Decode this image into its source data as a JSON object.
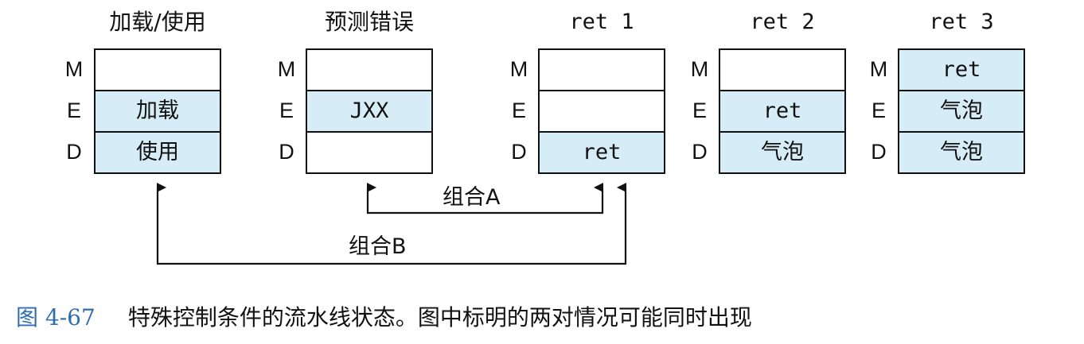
{
  "stages": [
    {
      "title": "加载/使用",
      "title_font": "cjk",
      "cells": {
        "M": "",
        "E": "加载",
        "D": "使用"
      },
      "filled": {
        "M": false,
        "E": true,
        "D": true
      }
    },
    {
      "title": "预测错误",
      "title_font": "cjk",
      "cells": {
        "M": "",
        "E": "JXX",
        "D": ""
      },
      "filled": {
        "M": false,
        "E": true,
        "D": false
      }
    },
    {
      "title": "ret 1",
      "title_font": "mono",
      "cells": {
        "M": "",
        "E": "",
        "D": "ret"
      },
      "filled": {
        "M": false,
        "E": false,
        "D": true
      }
    },
    {
      "title": "ret 2",
      "title_font": "mono",
      "cells": {
        "M": "",
        "E": "ret",
        "D": "气泡"
      },
      "filled": {
        "M": false,
        "E": true,
        "D": true
      }
    },
    {
      "title": "ret 3",
      "title_font": "mono",
      "cells": {
        "M": "ret",
        "E": "气泡",
        "D": "气泡"
      },
      "filled": {
        "M": true,
        "E": true,
        "D": true
      }
    }
  ],
  "row_labels": [
    "M",
    "E",
    "D"
  ],
  "connectors": {
    "combo_a": "组合A",
    "combo_b": "组合B"
  },
  "caption": {
    "figure_number": "图 4-67",
    "text": "特殊控制条件的流水线状态。图中标明的两对情况可能同时出现"
  },
  "colors": {
    "cell_fill": "#d6ecf6",
    "caption_number": "#2f6db0"
  }
}
